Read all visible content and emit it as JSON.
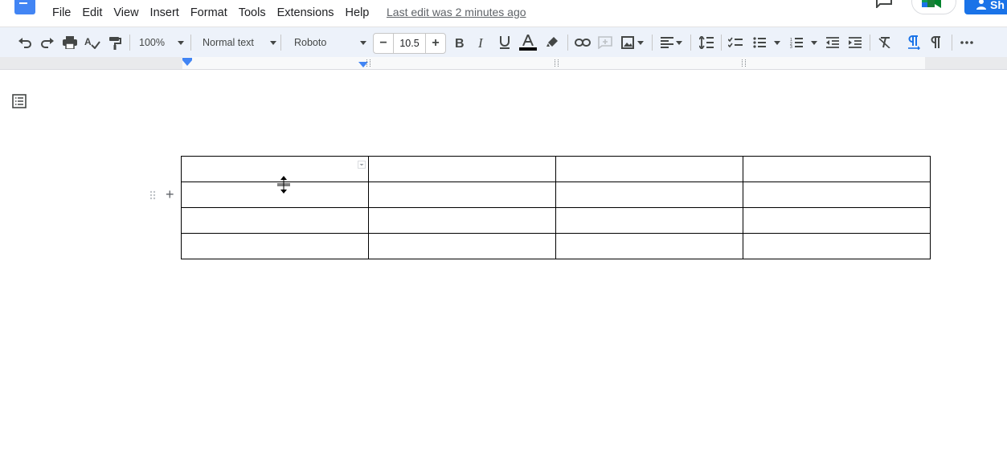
{
  "menu": {
    "items": [
      "File",
      "Edit",
      "View",
      "Insert",
      "Format",
      "Tools",
      "Extensions",
      "Help"
    ],
    "last_edit": "Last edit was 2 minutes ago",
    "share_label": "Sh"
  },
  "toolbar": {
    "zoom": "100%",
    "style": "Normal text",
    "font": "Roboto",
    "font_size": "10.5",
    "minus": "−",
    "plus": "+",
    "text_color": "#000000"
  },
  "table": {
    "rows": 4,
    "cols": 4,
    "cells": [
      [
        "",
        "",
        "",
        ""
      ],
      [
        "",
        "",
        "",
        ""
      ],
      [
        "",
        "",
        "",
        ""
      ],
      [
        "",
        "",
        "",
        ""
      ]
    ]
  },
  "row_controls": {
    "add_symbol": "+"
  },
  "colors": {
    "accent": "#1a73e8",
    "logo": "#4285f4",
    "toolbar_bg": "#edf2fa"
  }
}
